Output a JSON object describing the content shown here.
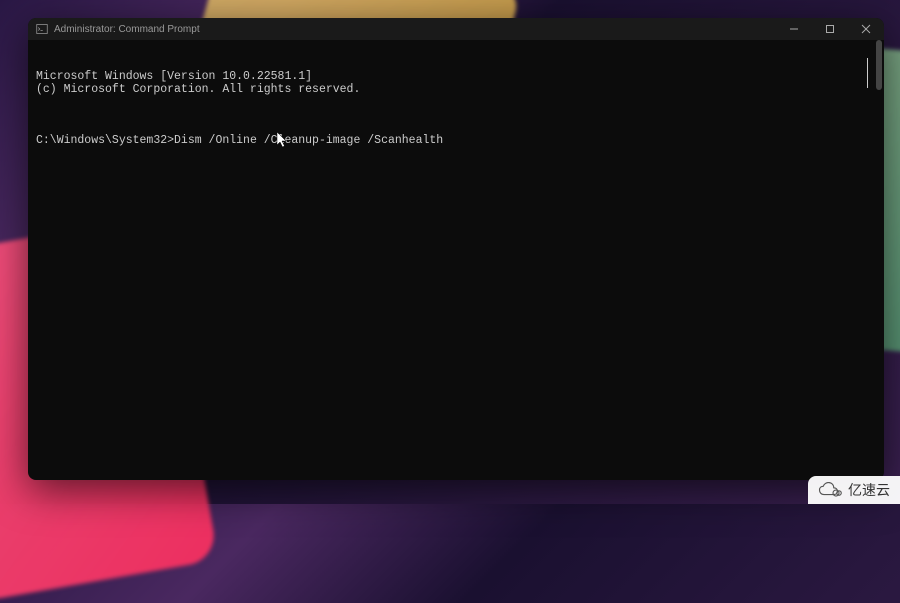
{
  "window": {
    "title": "Administrator: Command Prompt"
  },
  "terminal": {
    "line1": "Microsoft Windows [Version 10.0.22581.1]",
    "line2": "(c) Microsoft Corporation. All rights reserved.",
    "prompt": "C:\\Windows\\System32>",
    "command": "Dism /Online /Cleanup-image /Scanhealth"
  },
  "watermark": {
    "text": "亿速云"
  }
}
